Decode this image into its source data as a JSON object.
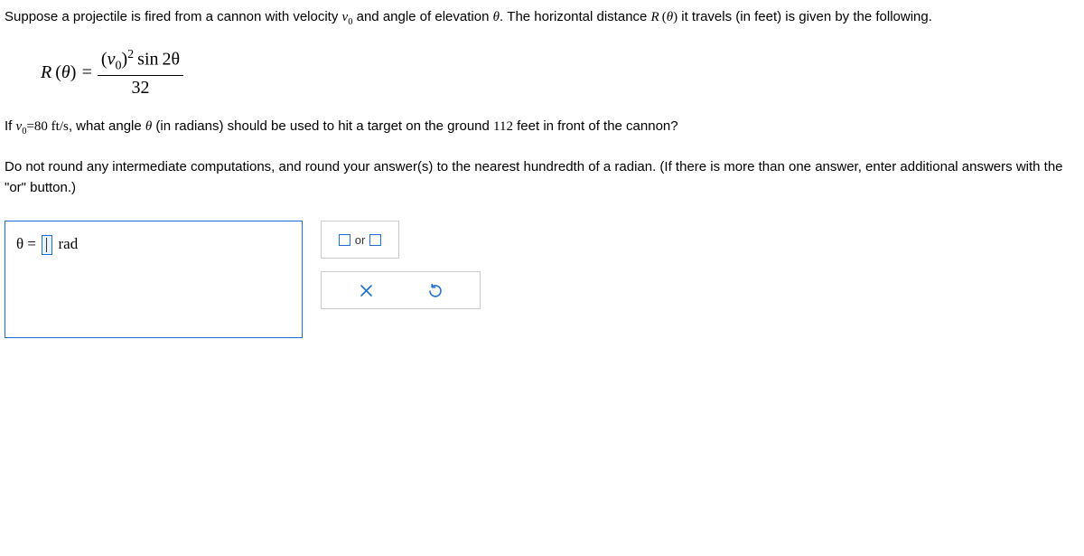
{
  "intro": "Suppose a projectile is fired from a cannon with velocity ",
  "intro2": " and angle of elevation ",
  "intro3": ". The horizontal distance ",
  "intro4": " it travels (in feet) is given by the following.",
  "formula": {
    "lhs_R": "R",
    "lhs_theta": "θ",
    "numerator_sin": "sin",
    "numerator_2theta": "2θ",
    "denominator": "32"
  },
  "q_part1": "If ",
  "q_velocity_eq": "=",
  "q_velocity_val": "80",
  "q_velocity_unit": " ft/s",
  "q_part2": ", what angle ",
  "q_part3": " (in radians) should be used to hit a target on the ground ",
  "q_distance": "112",
  "q_part4": " feet in front of the cannon?",
  "note": "Do not round any intermediate computations, and round your answer(s) to the nearest hundredth of a radian. (If there is more than one answer, enter additional answers with the \"or\" button.)",
  "answer_prefix": "θ = ",
  "answer_unit": " rad",
  "or_label": "or"
}
